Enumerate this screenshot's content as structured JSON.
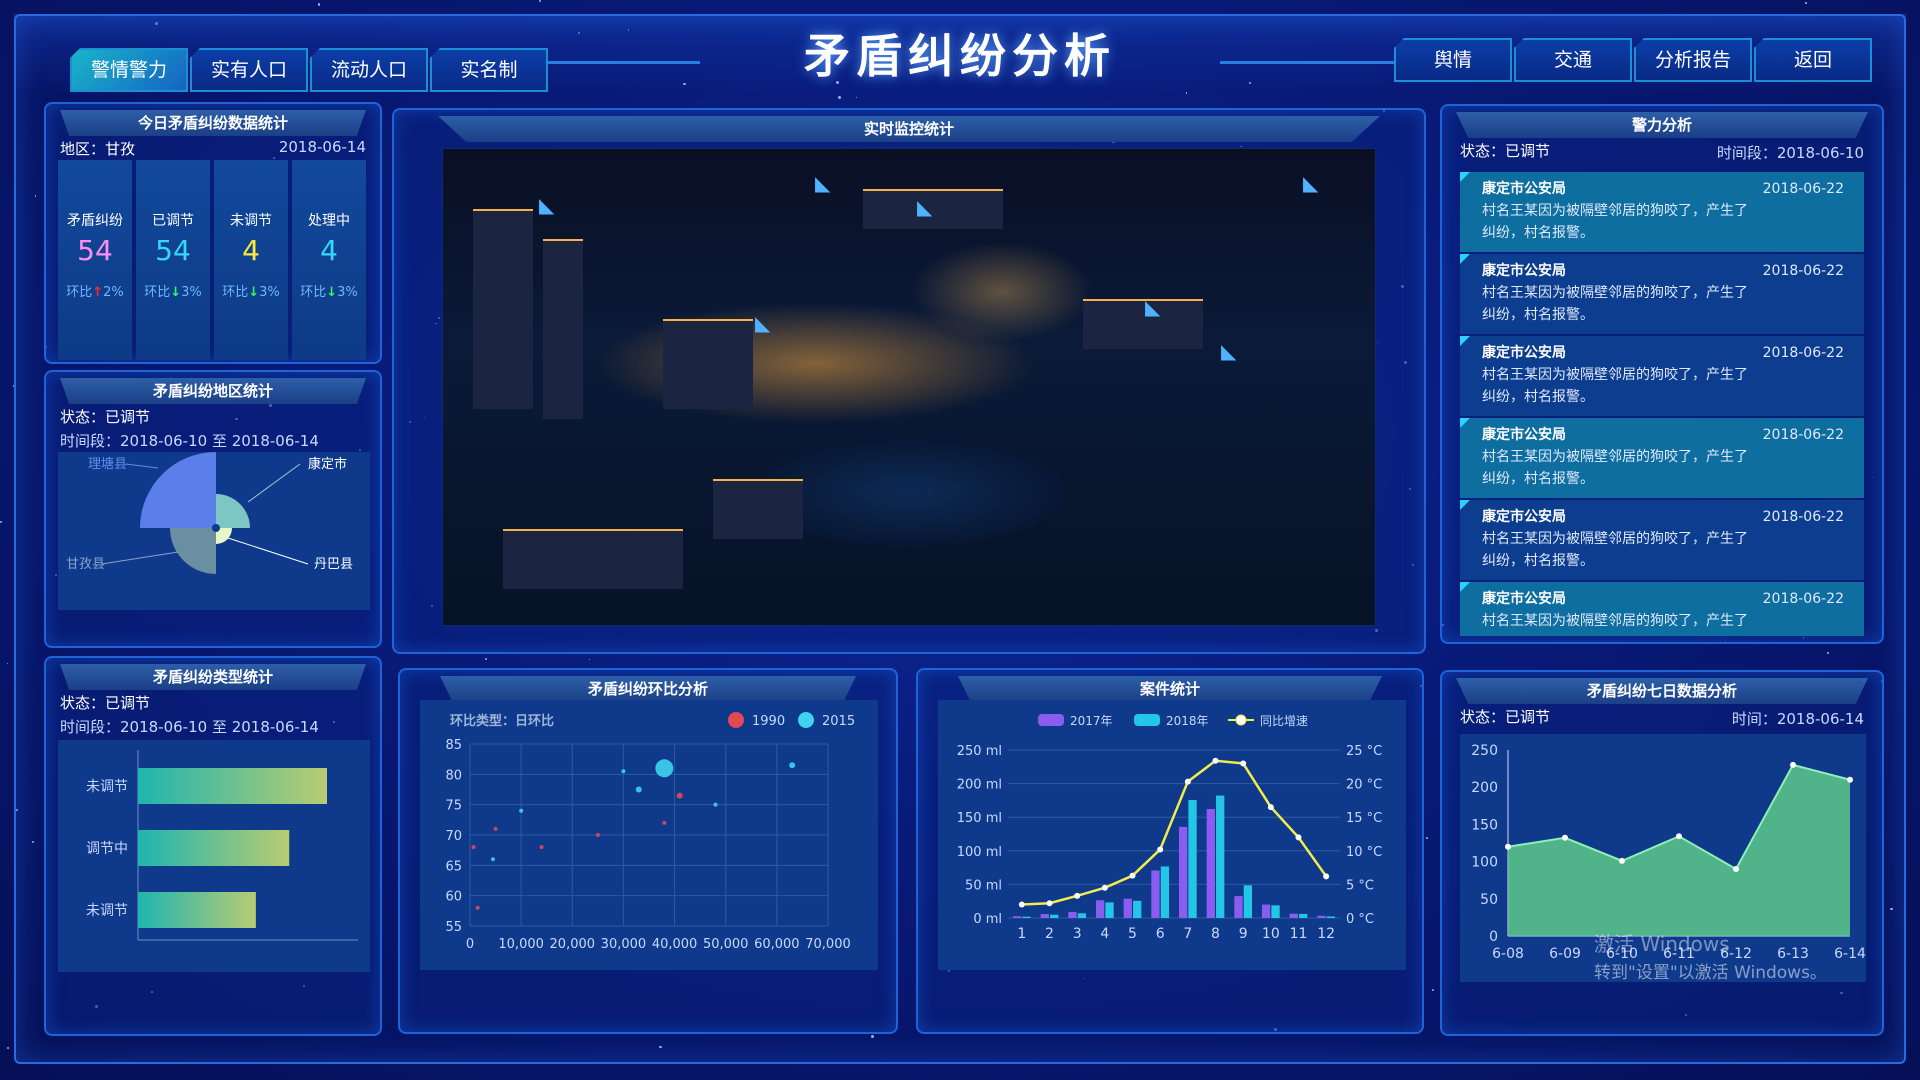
{
  "header": {
    "title": "矛盾纠纷分析",
    "left_tabs": [
      "警情警力",
      "实有人口",
      "流动人口",
      "实名制"
    ],
    "right_tabs": [
      "舆情",
      "交通",
      "分析报告",
      "返回"
    ]
  },
  "today_stats": {
    "title": "今日矛盾纠纷数据统计",
    "region": "地区：甘孜",
    "date": "2018-06-14",
    "items": [
      {
        "label": "矛盾纠纷",
        "value": "54",
        "compare": "环比",
        "pct": "2%",
        "trend": "up",
        "color": "#ff8df0"
      },
      {
        "label": "已调节",
        "value": "54",
        "compare": "环比",
        "pct": "3%",
        "trend": "down",
        "color": "#36d6ff"
      },
      {
        "label": "未调节",
        "value": "4",
        "compare": "环比",
        "pct": "3%",
        "trend": "down",
        "color": "#f7ea3c"
      },
      {
        "label": "处理中",
        "value": "4",
        "compare": "环比",
        "pct": "3%",
        "trend": "down",
        "color": "#36d6ff"
      }
    ]
  },
  "region_stats": {
    "title": "矛盾纠纷地区统计",
    "status": "状态：已调节",
    "period": "时间段：2018-06-10 至 2018-06-14",
    "labels": [
      "理塘县",
      "康定市",
      "甘孜县",
      "丹巴县"
    ]
  },
  "type_stats": {
    "title": "矛盾纠纷类型统计",
    "status": "状态：已调节",
    "period": "时间段：2018-06-10 至 2018-06-14",
    "categories": [
      "未调节",
      "调节中",
      "未调节"
    ],
    "values": [
      0.85,
      0.68,
      0.53
    ]
  },
  "monitor": {
    "title": "实时监控统计"
  },
  "police": {
    "title": "警力分析",
    "status": "状态：已调节",
    "period": "时间段：2018-06-10",
    "alerts": [
      {
        "org": "康定市公安局",
        "date": "2018-06-22",
        "line1": "村名王某因为被隔壁邻居的狗咬了，产生了",
        "line2": "纠纷，村名报警。"
      },
      {
        "org": "康定市公安局",
        "date": "2018-06-22",
        "line1": "村名王某因为被隔壁邻居的狗咬了，产生了",
        "line2": "纠纷，村名报警。"
      },
      {
        "org": "康定市公安局",
        "date": "2018-06-22",
        "line1": "村名王某因为被隔壁邻居的狗咬了，产生了",
        "line2": "纠纷，村名报警。"
      },
      {
        "org": "康定市公安局",
        "date": "2018-06-22",
        "line1": "村名王某因为被隔壁邻居的狗咬了，产生了",
        "line2": "纠纷，村名报警。"
      },
      {
        "org": "康定市公安局",
        "date": "2018-06-22",
        "line1": "村名王某因为被隔壁邻居的狗咬了，产生了",
        "line2": "纠纷，村名报警。"
      },
      {
        "org": "康定市公安局",
        "date": "2018-06-22",
        "line1": "村名王某因为被隔壁邻居的狗咬了，产生了",
        "line2": ""
      }
    ]
  },
  "ring_ratio": {
    "title": "矛盾纠纷环比分析",
    "type_label": "环比类型：日环比"
  },
  "case_stats": {
    "title": "案件统计"
  },
  "seven_day": {
    "title": "矛盾纠纷七日数据分析",
    "status": "状态：已调节",
    "time": "时间：2018-06-14"
  },
  "watermark": {
    "line1": "激活 Windows",
    "line2": "转到\"设置\"以激活 Windows。"
  },
  "chart_data": [
    {
      "type": "pie",
      "name": "矛盾纠纷地区统计",
      "rose": true,
      "categories": [
        "理塘县",
        "康定市",
        "丹巴县",
        "甘孜县"
      ],
      "values": [
        76,
        34,
        16,
        46
      ],
      "colors": [
        "#5b7fe8",
        "#7ec6c4",
        "#e8f7c8",
        "#6a8fa0"
      ]
    },
    {
      "type": "bar",
      "orientation": "horizontal",
      "name": "矛盾纠纷类型统计",
      "categories": [
        "未调节",
        "调节中",
        "未调节"
      ],
      "values": [
        0.85,
        0.68,
        0.53
      ]
    },
    {
      "type": "scatter",
      "name": "矛盾纠纷环比分析",
      "series": [
        {
          "name": "1990",
          "color": "#e04a50",
          "points": [
            [
              700,
              68
            ],
            [
              1500,
              58
            ],
            [
              5000,
              71
            ],
            [
              14000,
              68
            ],
            [
              25000,
              70
            ],
            [
              38000,
              72
            ],
            [
              41000,
              76.5
            ]
          ]
        },
        {
          "name": "2015",
          "color": "#3fd3f0",
          "points": [
            [
              4500,
              66
            ],
            [
              10000,
              74
            ],
            [
              30000,
              80.5
            ],
            [
              33000,
              77.5
            ],
            [
              38000,
              81
            ],
            [
              48000,
              75
            ],
            [
              63000,
              81.5
            ]
          ]
        }
      ],
      "bubble_sizes": {
        "1990": [
          2,
          2,
          2,
          2,
          2,
          2,
          3
        ],
        "2015": [
          2,
          2,
          2,
          3,
          9,
          2,
          3
        ]
      },
      "xlim": [
        0,
        70000
      ],
      "ylim": [
        55,
        85
      ],
      "xticks": [
        "0",
        "10,000",
        "20,000",
        "30,000",
        "40,000",
        "50,000",
        "60,000",
        "70,000"
      ],
      "yticks": [
        "55",
        "60",
        "65",
        "70",
        "75",
        "80",
        "85"
      ]
    },
    {
      "type": "bar",
      "name": "案件统计",
      "categories": [
        "1",
        "2",
        "3",
        "4",
        "5",
        "6",
        "7",
        "8",
        "9",
        "10",
        "11",
        "12"
      ],
      "series": [
        {
          "name": "2017年",
          "color": "#8a5cf0",
          "values": [
            2.6,
            5.9,
            9.0,
            26.4,
            28.7,
            70.7,
            135.6,
            162.2,
            32.6,
            20.0,
            6.4,
            3.3
          ]
        },
        {
          "name": "2018年",
          "color": "#23c6e6",
          "values": [
            2.0,
            4.9,
            7.0,
            23.2,
            25.6,
            76.7,
            175.6,
            182.2,
            48.7,
            18.8,
            6.0,
            2.3
          ]
        },
        {
          "name": "同比增速",
          "type": "line",
          "axis": "right",
          "color": "#f3ec4a",
          "values": [
            2.0,
            2.2,
            3.3,
            4.5,
            6.3,
            10.2,
            20.3,
            23.4,
            23.0,
            16.5,
            12.0,
            6.2
          ]
        }
      ],
      "ylim": [
        0,
        250
      ],
      "yticks": [
        "0 ml",
        "50 ml",
        "100 ml",
        "150 ml",
        "200 ml",
        "250 ml"
      ],
      "y2lim": [
        0,
        25
      ],
      "y2ticks": [
        "0 °C",
        "5 °C",
        "10 °C",
        "15 °C",
        "20 °C",
        "25 °C"
      ]
    },
    {
      "type": "area",
      "name": "矛盾纠纷七日数据分析",
      "categories": [
        "6-08",
        "6-09",
        "6-10",
        "6-11",
        "6-12",
        "6-13",
        "6-14"
      ],
      "values": [
        120,
        132,
        101,
        134,
        90,
        230,
        210
      ],
      "ylim": [
        0,
        250
      ],
      "yticks": [
        "0",
        "50",
        "100",
        "150",
        "200",
        "250"
      ]
    }
  ]
}
